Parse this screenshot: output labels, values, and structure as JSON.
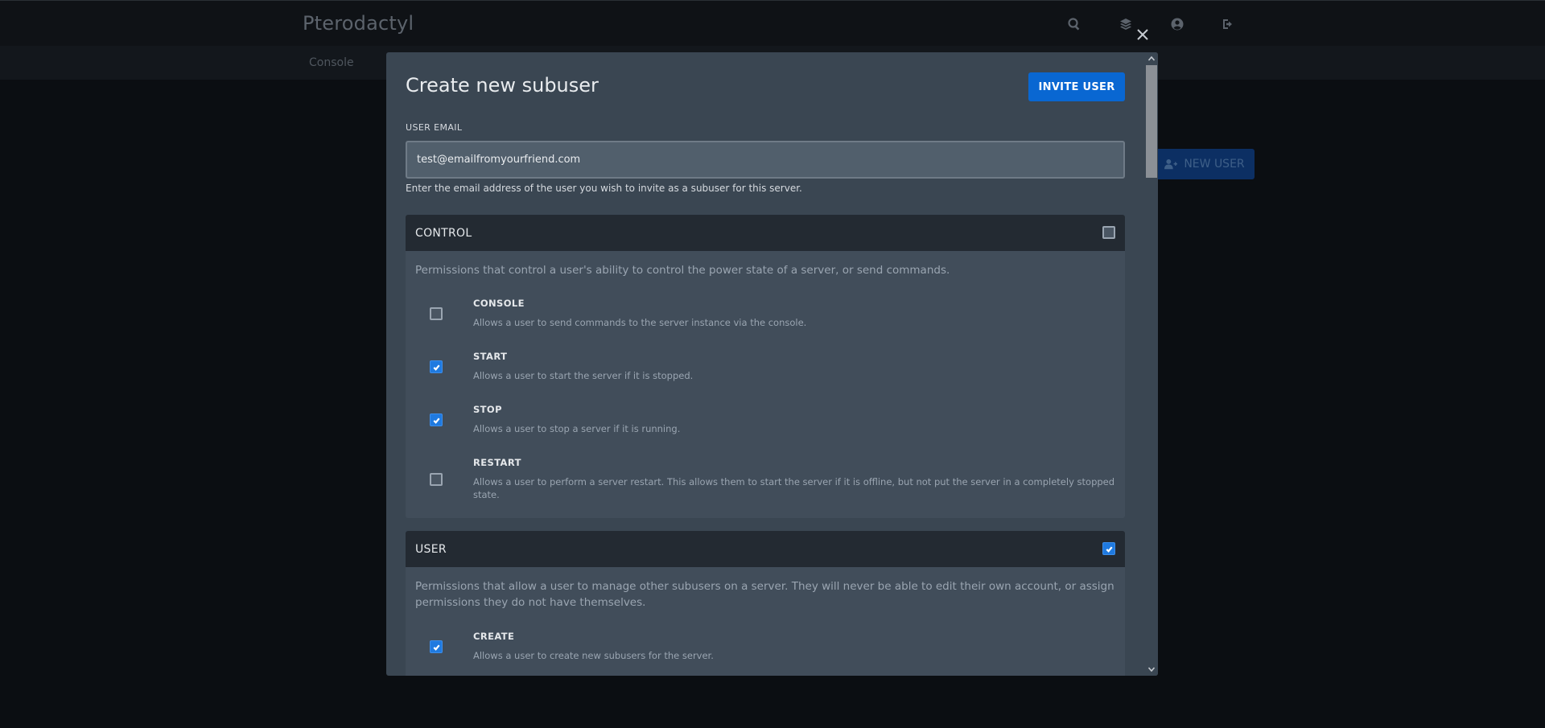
{
  "app": {
    "title": "Pterodactyl"
  },
  "topbar_icons": [
    "search-icon",
    "layers-icon",
    "user-circle-icon",
    "sign-out-icon"
  ],
  "subnav": {
    "items": [
      "Console"
    ]
  },
  "background_button": {
    "label": "NEW USER",
    "icon": "user-plus-icon"
  },
  "modal": {
    "title": "Create new subuser",
    "submit_label": "INVITE USER",
    "email": {
      "label": "USER EMAIL",
      "value": "test@emailfromyourfriend.com",
      "help": "Enter the email address of the user you wish to invite as a subuser for this server."
    },
    "groups": [
      {
        "name": "CONTROL",
        "checked": false,
        "description": "Permissions that control a user's ability to control the power state of a server, or send commands.",
        "permissions": [
          {
            "name": "CONSOLE",
            "checked": false,
            "description": "Allows a user to send commands to the server instance via the console."
          },
          {
            "name": "START",
            "checked": true,
            "description": "Allows a user to start the server if it is stopped."
          },
          {
            "name": "STOP",
            "checked": true,
            "description": "Allows a user to stop a server if it is running."
          },
          {
            "name": "RESTART",
            "checked": false,
            "description": "Allows a user to perform a server restart. This allows them to start the server if it is offline, but not put the server in a completely stopped state."
          }
        ]
      },
      {
        "name": "USER",
        "checked": true,
        "description": "Permissions that allow a user to manage other subusers on a server. They will never be able to edit their own account, or assign permissions they do not have themselves.",
        "permissions": [
          {
            "name": "CREATE",
            "checked": true,
            "description": "Allows a user to create new subusers for the server."
          }
        ]
      }
    ]
  },
  "colors": {
    "accent": "#0967d2",
    "modal_bg": "#3a4652",
    "group_header_bg": "#232a32",
    "checkbox_checked": "#1f7ae0"
  }
}
